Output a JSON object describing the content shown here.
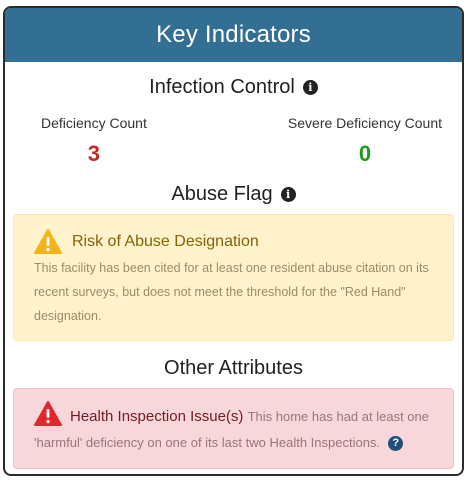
{
  "header": {
    "title": "Key Indicators"
  },
  "infection_control": {
    "title": "Infection Control",
    "info_icon": "info-icon",
    "deficiency_label": "Deficiency Count",
    "deficiency_value": "3",
    "severe_label": "Severe Deficiency Count",
    "severe_value": "0"
  },
  "abuse_flag": {
    "title": "Abuse Flag",
    "info_icon": "info-icon",
    "alert_icon": "warning-triangle-icon",
    "alert_title": "Risk of Abuse Designation",
    "alert_body": "This facility has been cited for at least one resident abuse citation on its recent surveys, but does not meet the threshold for the \"Red Hand\" designation."
  },
  "other_attributes": {
    "title": "Other Attributes",
    "alert_icon": "danger-triangle-icon",
    "alert_title": "Health Inspection Issue(s)",
    "alert_body": "This home has had at least one 'harmful' deficiency on one of its last two Health Inspections.",
    "help_icon": "question-circle-icon"
  },
  "colors": {
    "header_bg": "#336f93",
    "warning_bg": "#fff2cd",
    "danger_bg": "#f8d7da",
    "red_value": "#c62828",
    "green_value": "#1e9a1e"
  }
}
